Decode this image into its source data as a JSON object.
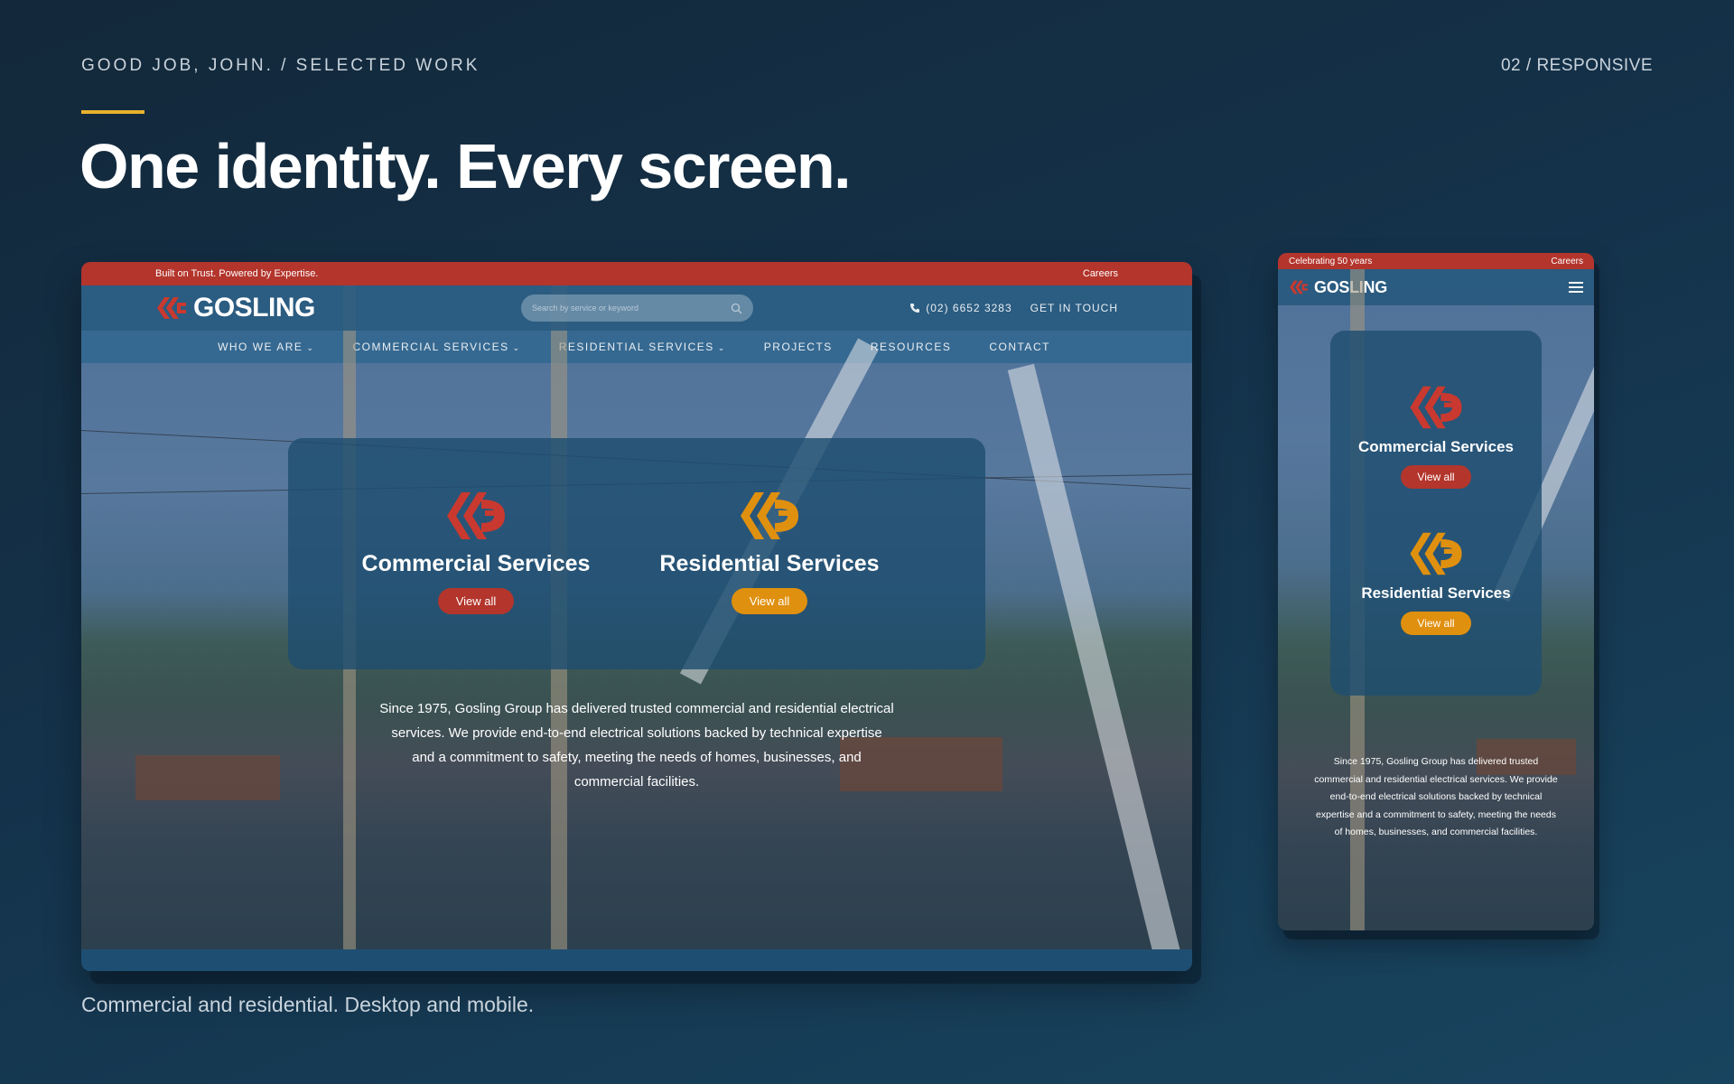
{
  "slide": {
    "kicker": "GOOD JOB, JOHN. / SELECTED WORK",
    "page_number": "02 / RESPONSIVE",
    "headline": "One identity. Every screen.",
    "caption": "Commercial and residential. Desktop and mobile.",
    "accent_color": "#e8b22c"
  },
  "desktop": {
    "topbar_left": "Built on Trust. Powered by Expertise.",
    "topbar_right": "Careers",
    "logo_text": "GOSLING",
    "search_placeholder": "Search by service or keyword",
    "phone": "(02) 6652 3283",
    "cta": "GET IN TOUCH",
    "nav": [
      {
        "label": "WHO WE ARE",
        "has_dropdown": true
      },
      {
        "label": "COMMERCIAL SERVICES",
        "has_dropdown": true
      },
      {
        "label": "RESIDENTIAL SERVICES",
        "has_dropdown": true
      },
      {
        "label": "PROJECTS",
        "has_dropdown": false
      },
      {
        "label": "RESOURCES",
        "has_dropdown": false
      },
      {
        "label": "CONTACT",
        "has_dropdown": false
      }
    ],
    "services": [
      {
        "title": "Commercial Services",
        "button": "View all",
        "color": "#b3352c"
      },
      {
        "title": "Residential Services",
        "button": "View all",
        "color": "#e0900f"
      }
    ],
    "intro": "Since 1975, Gosling Group has delivered trusted commercial and residential electrical services. We provide end-to-end electrical solutions backed by technical expertise and a commitment to safety, meeting the needs of homes, businesses, and commercial facilities.",
    "brand_red": "#b3352c",
    "brand_amber": "#e0900f"
  },
  "mobile": {
    "topbar_left": "Celebrating 50 years",
    "topbar_right": "Careers",
    "logo_text": "GOSLING",
    "services": [
      {
        "title": "Commercial Services",
        "button": "View all"
      },
      {
        "title": "Residential Services",
        "button": "View all"
      }
    ],
    "intro": "Since 1975, Gosling Group has delivered trusted commercial and residential electrical services. We provide end-to-end electrical solutions backed by technical expertise and a commitment to safety, meeting the needs of homes, businesses, and commercial facilities."
  }
}
